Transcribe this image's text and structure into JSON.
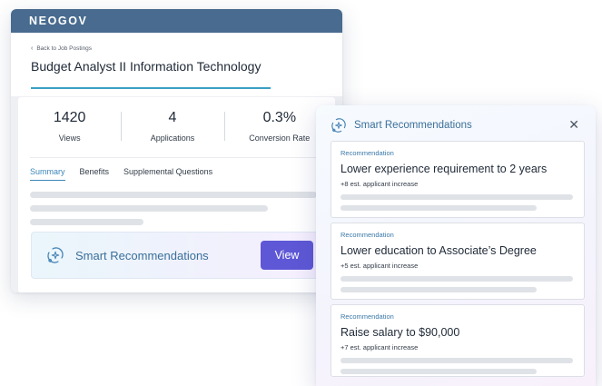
{
  "app": {
    "brand": "NEOGOV"
  },
  "posting": {
    "back_label": "Back to Job Postings",
    "title": "Budget Analyst II Information Technology"
  },
  "stats": [
    {
      "value": "1420",
      "label": "Views"
    },
    {
      "value": "4",
      "label": "Applications"
    },
    {
      "value": "0.3%",
      "label": "Conversion Rate"
    }
  ],
  "tabs": [
    {
      "label": "Summary",
      "active": true
    },
    {
      "label": "Benefits",
      "active": false
    },
    {
      "label": "Supplemental Questions",
      "active": false
    }
  ],
  "smart_bar": {
    "label": "Smart Recommendations",
    "button_label": "View"
  },
  "panel": {
    "title": "Smart Recommendations",
    "close_glyph": "✕",
    "recommendations": [
      {
        "tag": "Recommendation",
        "title": "Lower experience requirement to 2 years",
        "impact": "+8 est. applicant increase"
      },
      {
        "tag": "Recommendation",
        "title": "Lower education to Associate’s Degree",
        "impact": "+5 est. applicant increase"
      },
      {
        "tag": "Recommendation",
        "title": "Raise salary to $90,000",
        "impact": "+7 est. applicant increase"
      }
    ]
  },
  "colors": {
    "topbar": "#486b8f",
    "accent_blue": "#3c86b9",
    "view_button": "#5e58d6",
    "title_underline": "#3aa0c4"
  },
  "icons": {
    "sparkle": "sparkle-icon",
    "back": "chevron-left-icon",
    "close": "close-icon"
  }
}
